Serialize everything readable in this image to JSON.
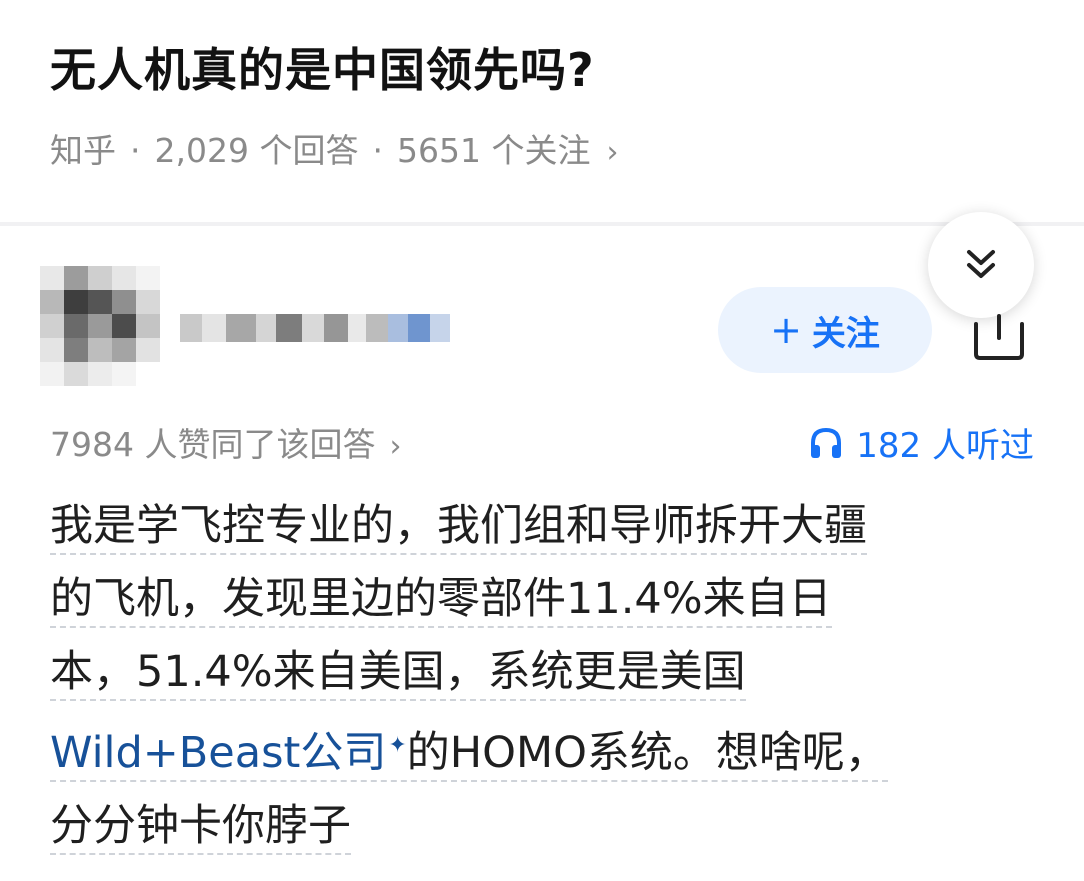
{
  "question": {
    "title": "无人机真的是中国领先吗?",
    "source": "知乎",
    "answers": "2,029 个回答",
    "followers": "5651 个关注"
  },
  "answer": {
    "follow_label": "关注",
    "votes": "7984 人赞同了该回答",
    "listened": "182 人听过",
    "content": {
      "line1": "我是学飞控专业的，我们组和导师拆开大疆",
      "line2": "的飞机，发现里边的零部件11.4%来自日",
      "line3": "本，51.4%来自美国，系统更是美国",
      "link_text": "Wild+Beast公司",
      "line4_rest": "的HOMO系统。想啥呢，",
      "line5": "分分钟卡你脖子"
    }
  },
  "icons": {
    "collapse": "double-chevron-down-icon",
    "share": "share-icon",
    "headphones": "headphones-icon",
    "link_mark": "sparkle-icon"
  },
  "colors": {
    "accent": "#1772f6",
    "link": "#175199",
    "muted": "#8a8a8a",
    "text": "#1f1f1f"
  }
}
